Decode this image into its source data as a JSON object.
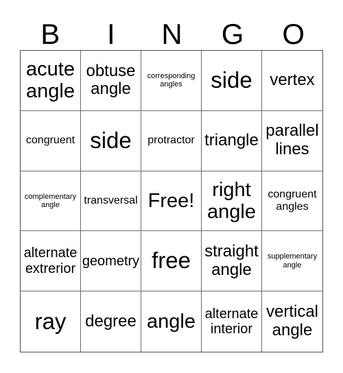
{
  "header": {
    "letters": [
      "B",
      "I",
      "N",
      "G",
      "O"
    ]
  },
  "cells": [
    "acute angle",
    "obtuse angle",
    "corresponding angles",
    "side",
    "vertex",
    "congruent",
    "side",
    "protractor",
    "triangle",
    "parallel lines",
    "complementary angle",
    "transversal",
    "Free!",
    "right angle",
    "congruent angles",
    "alternate extrerior",
    "geometry",
    "free",
    "straight angle",
    "supplementary angle",
    "ray",
    "degree",
    "angle",
    "alternate interior",
    "vertical angle"
  ]
}
